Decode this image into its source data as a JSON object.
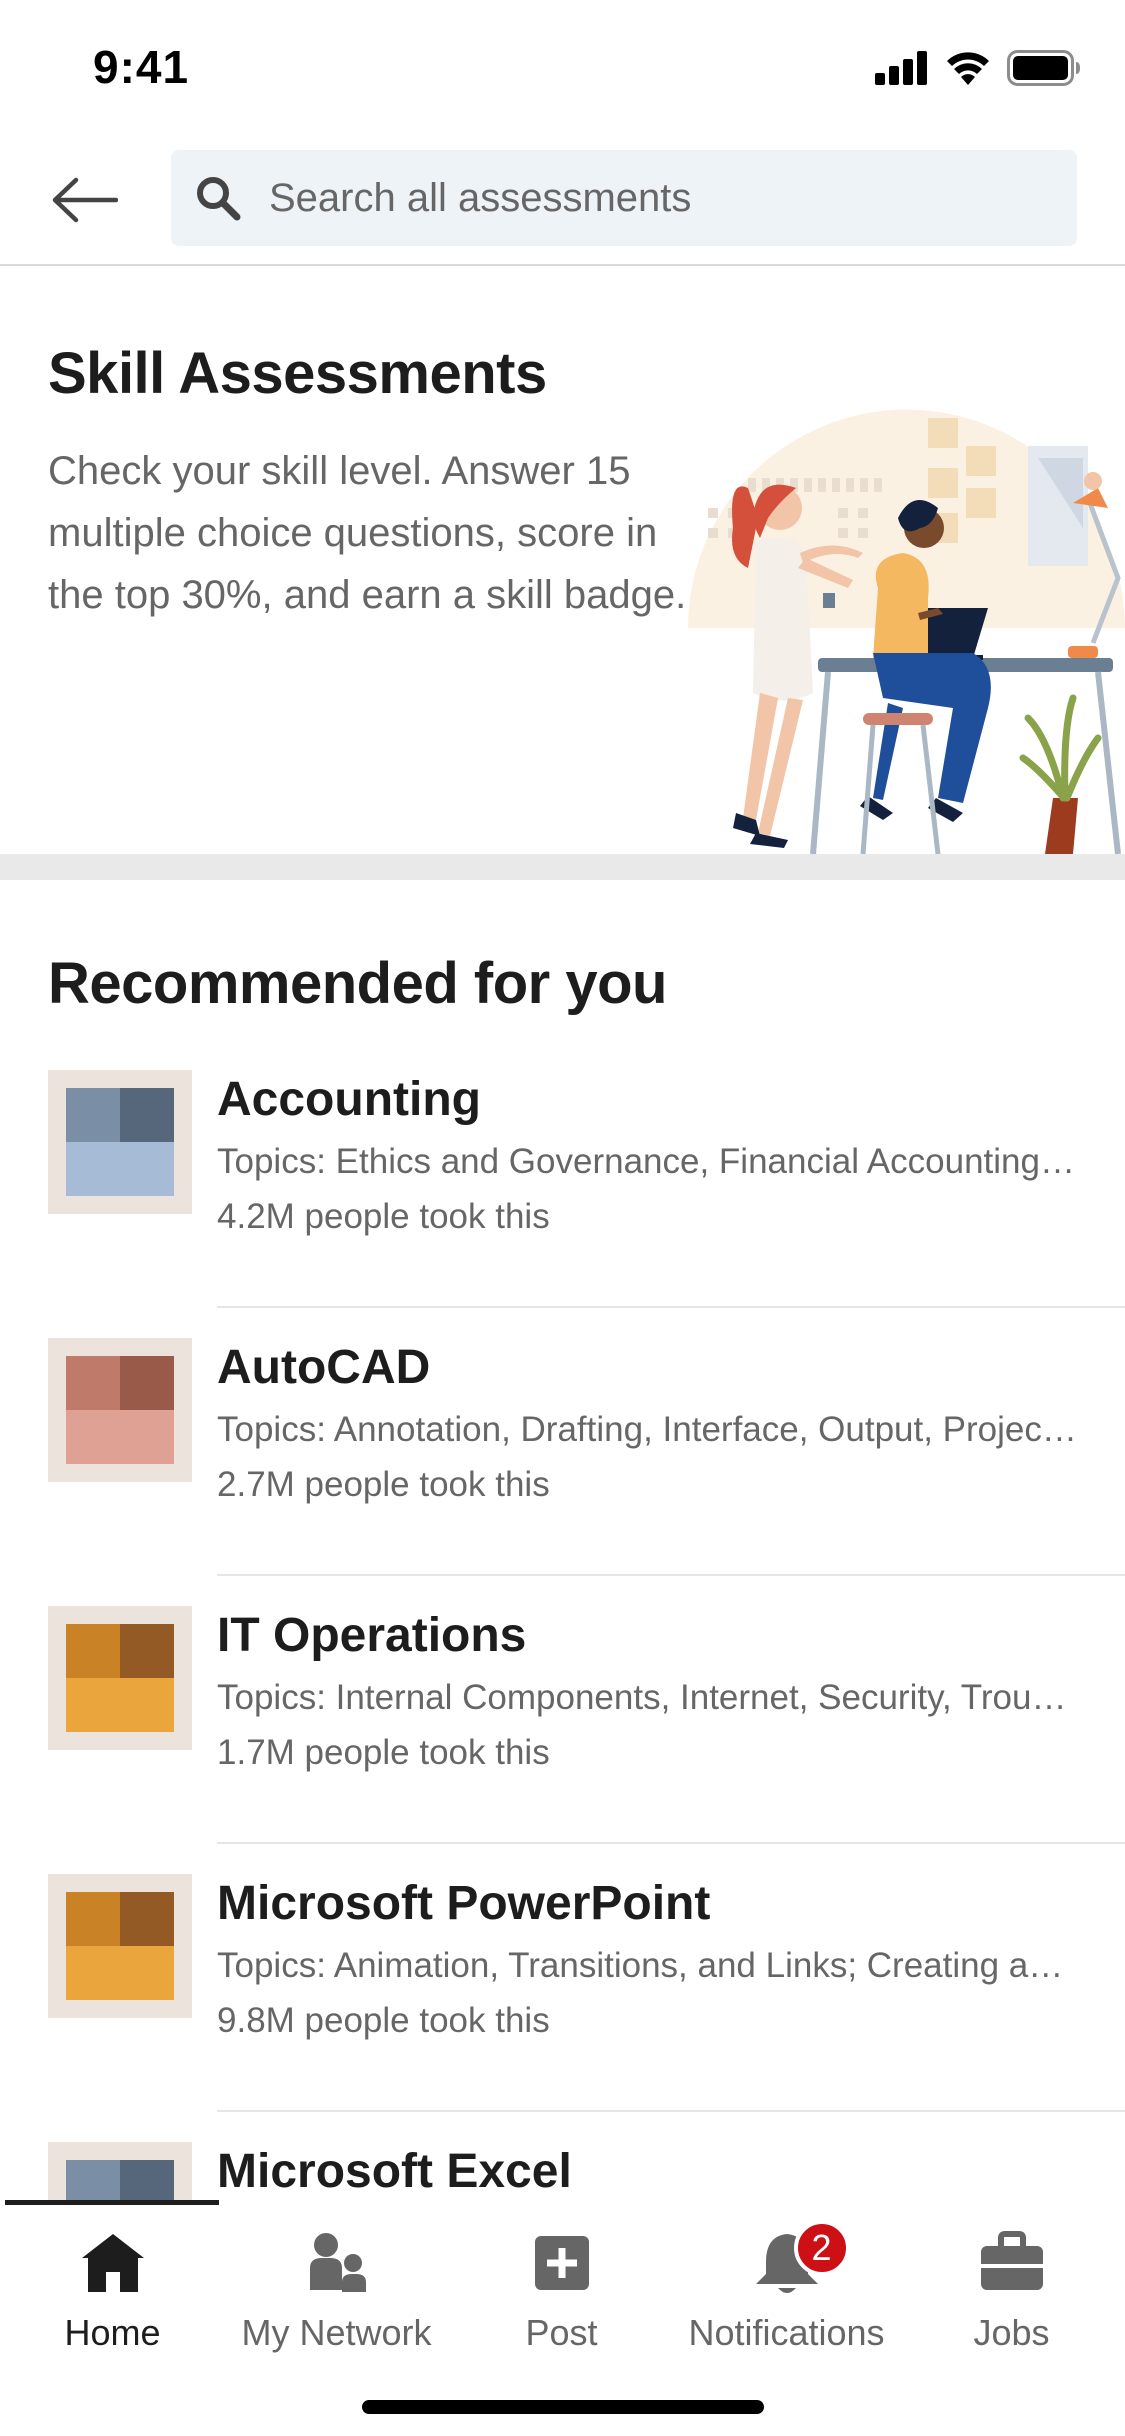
{
  "status_bar": {
    "time": "9:41"
  },
  "search": {
    "placeholder": "Search all assessments"
  },
  "intro": {
    "title": "Skill Assessments",
    "description": "Check your skill level. Answer 15 multiple choice questions, score in the top 30%, and earn a skill badge."
  },
  "recommended": {
    "title": "Recommended for you",
    "items": [
      {
        "name": "Accounting",
        "topics": "Topics: Ethics and Governance, Financial Accounting and Reporting",
        "count": "4.2M people took this",
        "colors": [
          "#7a8fa6",
          "#56677b",
          "#a6bcd6"
        ]
      },
      {
        "name": "AutoCAD",
        "topics": "Topics: Annotation, Drafting, Interface, Output, Project Management",
        "count": "2.7M people took this",
        "colors": [
          "#c07a6a",
          "#995a4a",
          "#e0a195"
        ]
      },
      {
        "name": "IT Operations",
        "topics": "Topics: Internal Components, Internet, Security, Troubleshooting",
        "count": "1.7M people took this",
        "colors": [
          "#c98226",
          "#945a26",
          "#eaa63c"
        ]
      },
      {
        "name": "Microsoft PowerPoint",
        "topics": "Topics: Animation, Transitions, and Links; Creating and Managing Presentations",
        "count": "9.8M people took this",
        "colors": [
          "#c98226",
          "#945a26",
          "#eaa63c"
        ]
      },
      {
        "name": "Microsoft Excel",
        "topics": "",
        "count": "",
        "colors": [
          "#7a8fa6",
          "#56677b",
          "#a6bcd6"
        ]
      }
    ]
  },
  "tabs": [
    {
      "label": "Home",
      "icon": "home-icon",
      "active": true
    },
    {
      "label": "My Network",
      "icon": "people-icon",
      "active": false
    },
    {
      "label": "Post",
      "icon": "plus-square-icon",
      "active": false
    },
    {
      "label": "Notifications",
      "icon": "bell-icon",
      "active": false,
      "badge": "2"
    },
    {
      "label": "Jobs",
      "icon": "briefcase-icon",
      "active": false
    }
  ],
  "colors": {
    "search_bg": "#eef3f8",
    "badge": "#cc1016",
    "text_primary": "#1d1d1d",
    "text_secondary": "#666666"
  }
}
